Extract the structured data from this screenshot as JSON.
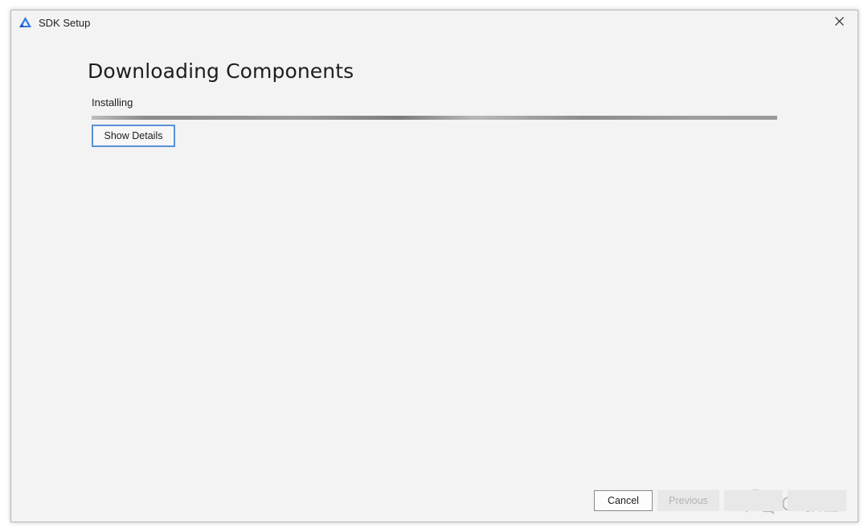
{
  "window": {
    "title": "SDK Setup",
    "app_icon": "harmony-triangle-icon",
    "close_icon": "close-icon"
  },
  "page": {
    "heading": "Downloading Components",
    "status": "Installing",
    "progress_fraction": 1.0,
    "show_details_label": "Show Details"
  },
  "footer": {
    "cancel_label": "Cancel",
    "previous_label": "Previous",
    "previous_enabled": false,
    "next_label": "",
    "next_enabled": false,
    "finish_label": "",
    "finish_enabled": false
  },
  "watermark": {
    "icon": "wechat-icon",
    "text": "C4教程"
  },
  "colors": {
    "accent_border": "#5b8fd6",
    "window_bg": "#f3f3f3",
    "app_icon_blue": "#2f7ae5"
  }
}
